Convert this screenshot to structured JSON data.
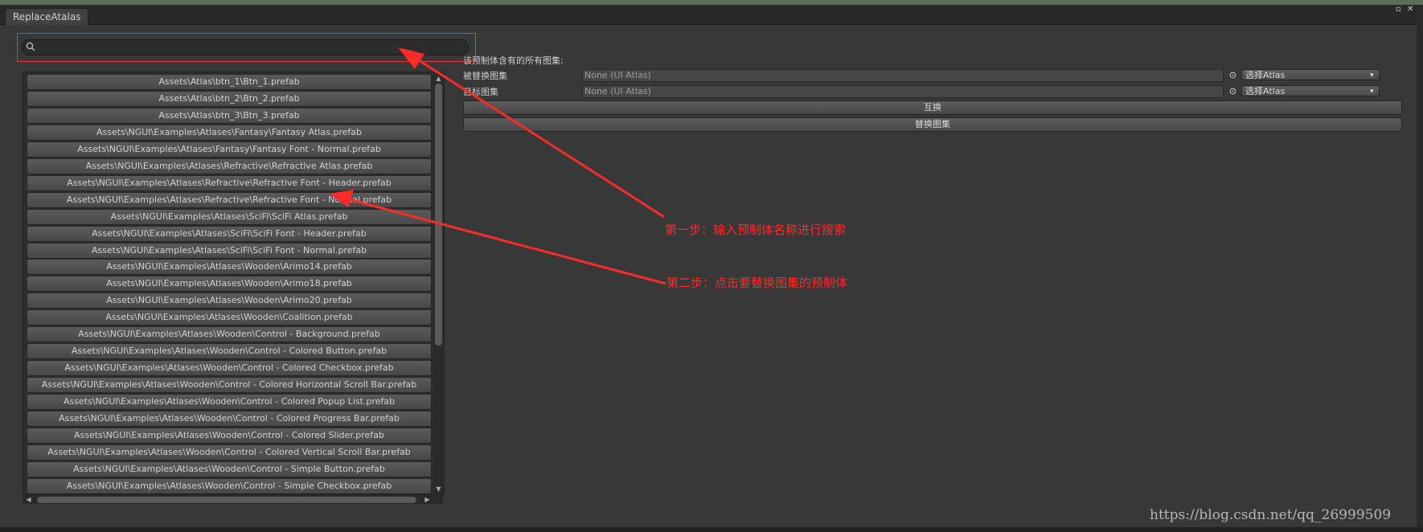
{
  "window": {
    "tab_title": "ReplaceAtalas",
    "ctl_maximize": "▫",
    "ctl_close": "✕"
  },
  "search": {
    "value": "",
    "placeholder": "",
    "icon": "search-icon"
  },
  "list": {
    "items": [
      "Assets\\Atlas\\btn_1\\Btn_1.prefab",
      "Assets\\Atlas\\btn_2\\Btn_2.prefab",
      "Assets\\Atlas\\btn_3\\Btn_3.prefab",
      "Assets\\NGUI\\Examples\\Atlases\\Fantasy\\Fantasy Atlas.prefab",
      "Assets\\NGUI\\Examples\\Atlases\\Fantasy\\Fantasy Font - Normal.prefab",
      "Assets\\NGUI\\Examples\\Atlases\\Refractive\\Refractive Atlas.prefab",
      "Assets\\NGUI\\Examples\\Atlases\\Refractive\\Refractive Font - Header.prefab",
      "Assets\\NGUI\\Examples\\Atlases\\Refractive\\Refractive Font - Normal.prefab",
      "Assets\\NGUI\\Examples\\Atlases\\SciFi\\SciFi Atlas.prefab",
      "Assets\\NGUI\\Examples\\Atlases\\SciFi\\SciFi Font - Header.prefab",
      "Assets\\NGUI\\Examples\\Atlases\\SciFi\\SciFi Font - Normal.prefab",
      "Assets\\NGUI\\Examples\\Atlases\\Wooden\\Arimo14.prefab",
      "Assets\\NGUI\\Examples\\Atlases\\Wooden\\Arimo18.prefab",
      "Assets\\NGUI\\Examples\\Atlases\\Wooden\\Arimo20.prefab",
      "Assets\\NGUI\\Examples\\Atlases\\Wooden\\Coalition.prefab",
      "Assets\\NGUI\\Examples\\Atlases\\Wooden\\Control - Background.prefab",
      "Assets\\NGUI\\Examples\\Atlases\\Wooden\\Control - Colored Button.prefab",
      "Assets\\NGUI\\Examples\\Atlases\\Wooden\\Control - Colored Checkbox.prefab",
      "Assets\\NGUI\\Examples\\Atlases\\Wooden\\Control - Colored Horizontal Scroll Bar.prefab",
      "Assets\\NGUI\\Examples\\Atlases\\Wooden\\Control - Colored Popup List.prefab",
      "Assets\\NGUI\\Examples\\Atlases\\Wooden\\Control - Colored Progress Bar.prefab",
      "Assets\\NGUI\\Examples\\Atlases\\Wooden\\Control - Colored Slider.prefab",
      "Assets\\NGUI\\Examples\\Atlases\\Wooden\\Control - Colored Vertical Scroll Bar.prefab",
      "Assets\\NGUI\\Examples\\Atlases\\Wooden\\Control - Simple Button.prefab",
      "Assets\\NGUI\\Examples\\Atlases\\Wooden\\Control - Simple Checkbox.prefab"
    ]
  },
  "scroll": {
    "arrow_up": "▲",
    "arrow_down": "▼",
    "arrow_left": "◀",
    "arrow_right": "▶"
  },
  "details": {
    "heading": "该预制体含有的所有图集:",
    "replaced_label": "被替换图集",
    "replaced_value": "None (UI Atlas)",
    "target_label": "目标图集",
    "target_value": "None (UI Atlas)",
    "select_atlas": "选择Atlas",
    "dropdown_arrow": "▾",
    "swap_button": "互换",
    "replace_button": "替换图集"
  },
  "annotations": {
    "step1": "第一步：输入预制体名称进行搜索",
    "step2": "第二步：点击要替换图集的预制体",
    "color": "#ff2a2a"
  },
  "watermark": "https://blog.csdn.net/qq_26999509",
  "colors": {
    "background": "#383838",
    "highlight_border": "#e03a3a"
  }
}
